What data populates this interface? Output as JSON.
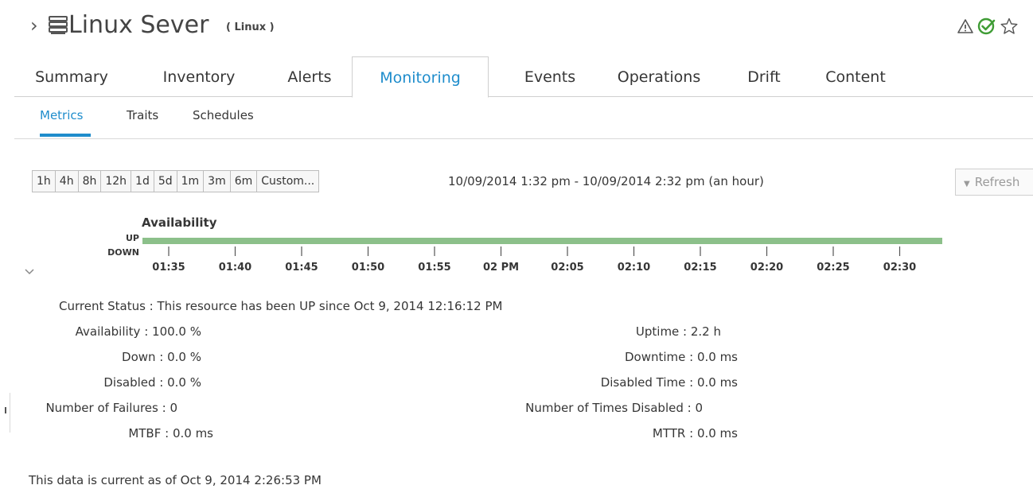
{
  "header": {
    "breadcrumb_chevron": "›",
    "resource_icon": "server-stack-icon",
    "resource_name": "Linux Sever",
    "resource_type": "( Linux )",
    "icons": [
      "warning-icon",
      "check-circle-icon",
      "favorite-star-icon"
    ],
    "colors": {
      "ok": "#3f9c35",
      "icon": "#555555"
    }
  },
  "tabs": [
    {
      "label": "Summary",
      "active": false
    },
    {
      "label": "Inventory",
      "active": false
    },
    {
      "label": "Alerts",
      "active": false
    },
    {
      "label": "Monitoring",
      "active": true
    },
    {
      "label": "Events",
      "active": false
    },
    {
      "label": "Operations",
      "active": false
    },
    {
      "label": "Drift",
      "active": false
    },
    {
      "label": "Content",
      "active": false
    }
  ],
  "subtabs": [
    {
      "label": "Metrics",
      "active": true
    },
    {
      "label": "Traits",
      "active": false
    },
    {
      "label": "Schedules",
      "active": false
    }
  ],
  "range_buttons": [
    "1h",
    "4h",
    "8h",
    "12h",
    "1d",
    "5d",
    "1m",
    "3m",
    "6m",
    "Custom..."
  ],
  "date_range": "10/09/2014 1:32 pm - 10/09/2014 2:32 pm (an hour)",
  "refresh_label": "Refresh",
  "availability": {
    "title": "Availability",
    "y_labels": [
      "UP",
      "DOWN"
    ],
    "x_ticks": [
      "01:35",
      "01:40",
      "01:45",
      "01:50",
      "01:55",
      "02 PM",
      "02:05",
      "02:10",
      "02:15",
      "02:20",
      "02:25",
      "02:30"
    ],
    "status": "UP",
    "bar_color": "#8cc08a"
  },
  "stats": {
    "current_status": "Current Status : This resource has been UP since Oct 9, 2014 12:16:12 PM",
    "left": [
      "Availability : 100.0 %",
      "Down : 0.0 %",
      "Disabled : 0.0 %",
      "Number of Failures : 0",
      "MTBF : 0.0 ms"
    ],
    "right": [
      "Uptime : 2.2 h",
      "Downtime : 0.0 ms",
      "Disabled Time : 0.0 ms",
      "Number of Times Disabled : 0",
      "MTTR : 0.0 ms"
    ]
  },
  "footer_note": "This data is current as of Oct 9, 2014 2:26:53 PM"
}
